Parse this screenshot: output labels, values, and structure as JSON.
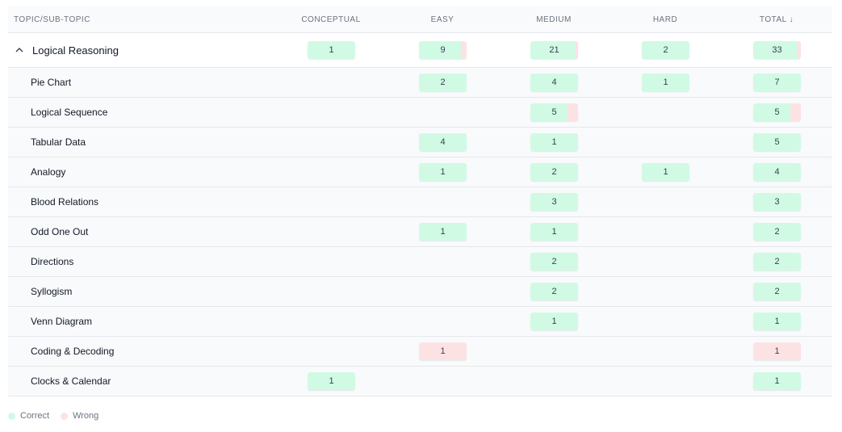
{
  "colors": {
    "correct": "#d1fae5",
    "wrong": "#fde2e4"
  },
  "header": {
    "topic": "TOPIC/SUB-TOPIC",
    "conceptual": "CONCEPTUAL",
    "easy": "EASY",
    "medium": "MEDIUM",
    "hard": "HARD",
    "total": "TOTAL ↓"
  },
  "group": {
    "name": "Logical Reasoning",
    "icon": "chevron-up-icon",
    "cells": {
      "conceptual": {
        "value": "1",
        "correct_fraction": 1
      },
      "easy": {
        "value": "9",
        "correct_fraction": 0.88
      },
      "medium": {
        "value": "21",
        "correct_fraction": 0.95
      },
      "hard": {
        "value": "2",
        "correct_fraction": 1
      },
      "total": {
        "value": "33",
        "correct_fraction": 0.94
      }
    }
  },
  "rows": [
    {
      "name": "Pie Chart",
      "cells": {
        "easy": {
          "value": "2",
          "correct_fraction": 1
        },
        "medium": {
          "value": "4",
          "correct_fraction": 1
        },
        "hard": {
          "value": "1",
          "correct_fraction": 1
        },
        "total": {
          "value": "7",
          "correct_fraction": 1
        }
      }
    },
    {
      "name": "Logical Sequence",
      "cells": {
        "medium": {
          "value": "5",
          "correct_fraction": 0.78
        },
        "total": {
          "value": "5",
          "correct_fraction": 0.78
        }
      }
    },
    {
      "name": "Tabular Data",
      "cells": {
        "easy": {
          "value": "4",
          "correct_fraction": 1
        },
        "medium": {
          "value": "1",
          "correct_fraction": 1
        },
        "total": {
          "value": "5",
          "correct_fraction": 1
        }
      }
    },
    {
      "name": "Analogy",
      "cells": {
        "easy": {
          "value": "1",
          "correct_fraction": 1
        },
        "medium": {
          "value": "2",
          "correct_fraction": 1
        },
        "hard": {
          "value": "1",
          "correct_fraction": 1
        },
        "total": {
          "value": "4",
          "correct_fraction": 1
        }
      }
    },
    {
      "name": "Blood Relations",
      "cells": {
        "medium": {
          "value": "3",
          "correct_fraction": 1
        },
        "total": {
          "value": "3",
          "correct_fraction": 1
        }
      }
    },
    {
      "name": "Odd One Out",
      "cells": {
        "easy": {
          "value": "1",
          "correct_fraction": 1
        },
        "medium": {
          "value": "1",
          "correct_fraction": 1
        },
        "total": {
          "value": "2",
          "correct_fraction": 1
        }
      }
    },
    {
      "name": "Directions",
      "cells": {
        "medium": {
          "value": "2",
          "correct_fraction": 1
        },
        "total": {
          "value": "2",
          "correct_fraction": 1
        }
      }
    },
    {
      "name": "Syllogism",
      "cells": {
        "medium": {
          "value": "2",
          "correct_fraction": 1
        },
        "total": {
          "value": "2",
          "correct_fraction": 1
        }
      }
    },
    {
      "name": "Venn Diagram",
      "cells": {
        "medium": {
          "value": "1",
          "correct_fraction": 1
        },
        "total": {
          "value": "1",
          "correct_fraction": 1
        }
      }
    },
    {
      "name": "Coding & Decoding",
      "cells": {
        "easy": {
          "value": "1",
          "correct_fraction": 0
        },
        "total": {
          "value": "1",
          "correct_fraction": 0
        }
      }
    },
    {
      "name": "Clocks & Calendar",
      "cells": {
        "conceptual": {
          "value": "1",
          "correct_fraction": 1
        },
        "total": {
          "value": "1",
          "correct_fraction": 1
        }
      }
    }
  ],
  "legend": {
    "correct": "Correct",
    "wrong": "Wrong"
  }
}
